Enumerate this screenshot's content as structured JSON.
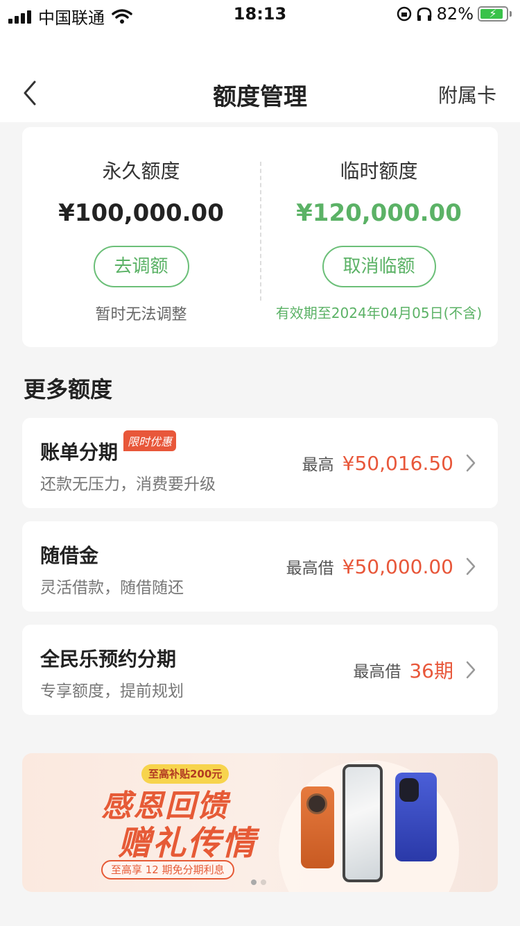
{
  "status_bar": {
    "carrier": "中国联通",
    "time": "18:13",
    "battery": "82%"
  },
  "nav": {
    "title": "额度管理",
    "right_label": "附属卡"
  },
  "limits": {
    "permanent": {
      "label": "永久额度",
      "amount": "¥100,000.00",
      "button": "去调额",
      "note": "暂时无法调整"
    },
    "temporary": {
      "label": "临时额度",
      "amount": "¥120,000.00",
      "button": "取消临额",
      "note": "有效期至2024年04月05日(不含)"
    }
  },
  "more": {
    "title": "更多额度",
    "items": [
      {
        "title": "账单分期",
        "tag": "限时优惠",
        "subtitle": "还款无压力，消费要升级",
        "prefix": "最高",
        "value": "¥50,016.50"
      },
      {
        "title": "随借金",
        "subtitle": "灵活借款，随借随还",
        "prefix": "最高借",
        "value": "¥50,000.00"
      },
      {
        "title": "全民乐预约分期",
        "subtitle": "专享额度，提前规划",
        "prefix": "最高借",
        "value": "36期"
      }
    ]
  },
  "banner": {
    "badge": "至高补贴200元",
    "headline1": "感恩回馈",
    "headline2": "赠礼传情",
    "pill": "至高享 12 期免分期利息"
  },
  "colors": {
    "accent_green": "#5bb266",
    "accent_orange": "#e8573a"
  }
}
